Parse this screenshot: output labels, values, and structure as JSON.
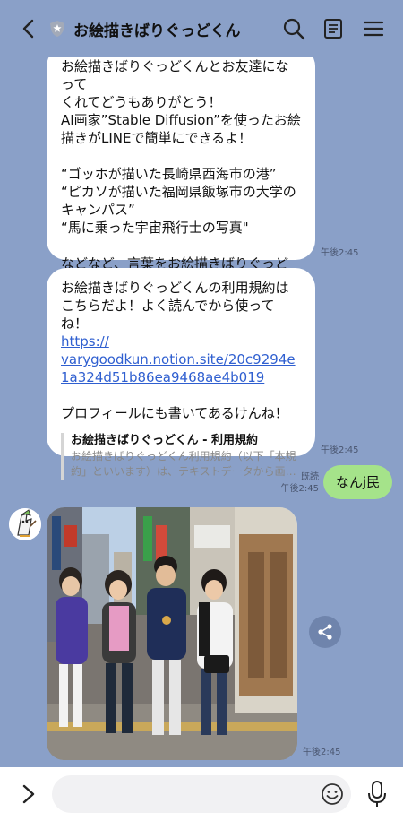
{
  "header": {
    "title": "お絵描きばりぐっどくん"
  },
  "messages": {
    "bot1": {
      "text": "お絵描きばりぐっどくんとお友達になって\nくれてどうもありがとう！\nAI画家”Stable Diffusion”を使ったお絵描きがLINEで簡単にできるよ！\n\n“ゴッホが描いた長崎県西海市の港”\n“ピカソが描いた福岡県飯塚市の大学のキャンパス”\n“馬に乗った宇宙飛行士の写真\"\n\nなどなど、言葉をお絵描きばりぐっどくんに送ってみてね！",
      "time": "午後2:45"
    },
    "bot2": {
      "text_before": "お絵描きばりぐっどくんの利用規約はこちらだよ！よく読んでから使ってね！",
      "link": "https://\nvarygoodkun.notion.site/20c9294e1a324d51b86ea9468ae4b019",
      "text_after": "プロフィールにも書いてあるけんね！",
      "preview_title": "お絵描きばりぐっどくん - 利用規約",
      "preview_desc": "お絵描きばりぐっどくん利用規約（以下「本規約」といいます）は、テキストデータから画…",
      "time": "午後2:45"
    },
    "me1": {
      "text": "なんj民",
      "read": "既読",
      "time": "午後2:45"
    },
    "photo": {
      "time": "午後2:45"
    }
  },
  "input": {
    "placeholder": ""
  },
  "colors": {
    "background": "#8aa0c8",
    "my_bubble": "#a5e38a",
    "link": "#2f5fd0"
  }
}
